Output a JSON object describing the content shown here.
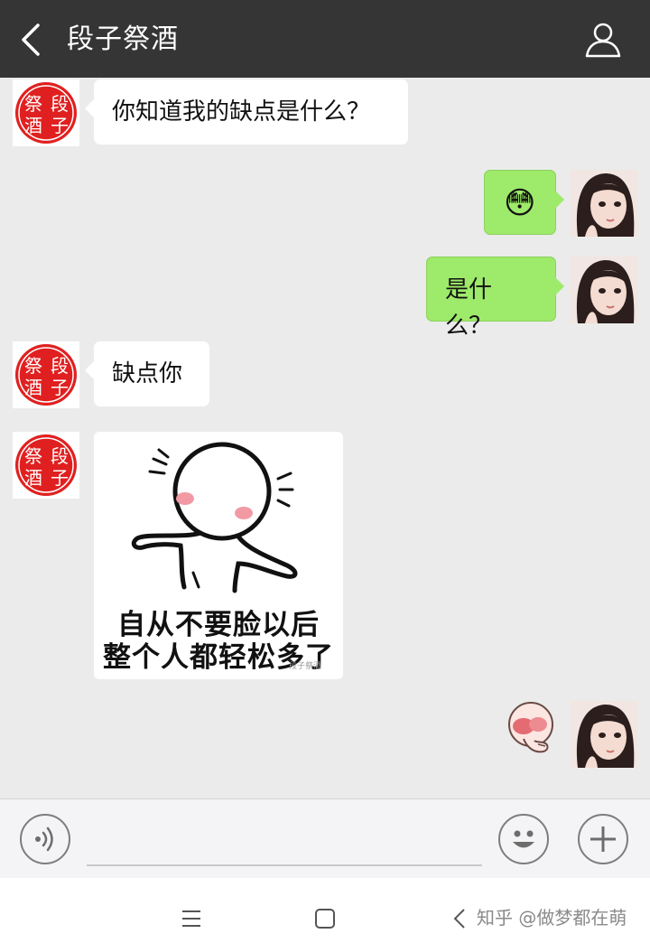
{
  "header": {
    "title": "段子祭酒"
  },
  "contact_avatar": {
    "stamp_chars": [
      "段",
      "子",
      "祭",
      "酒"
    ],
    "stamp_color": "#e02020"
  },
  "messages": [
    {
      "side": "left",
      "type": "text",
      "text": "你知道我的缺点是什么？"
    },
    {
      "side": "right",
      "type": "emoji",
      "emoji": "😳"
    },
    {
      "side": "right",
      "type": "text",
      "text": "是什么？"
    },
    {
      "side": "left",
      "type": "text",
      "text": "缺点你"
    },
    {
      "side": "left",
      "type": "sticker",
      "caption_line1": "自从不要脸以后",
      "caption_line2": "整个人都轻松多了",
      "source_mark": "段子祭酒"
    },
    {
      "side": "right",
      "type": "sticker",
      "icon": "blushing-face-sticker-icon"
    }
  ],
  "input_bar": {
    "voice_icon": "voice-icon",
    "emoji_icon": "smiley-icon",
    "more_icon": "plus-icon"
  },
  "watermark": {
    "text": "知乎 @做梦都在萌"
  },
  "colors": {
    "header_bg": "#353535",
    "chat_bg": "#ebebeb",
    "sent_bubble": "#9eea6a",
    "received_bubble": "#ffffff"
  }
}
